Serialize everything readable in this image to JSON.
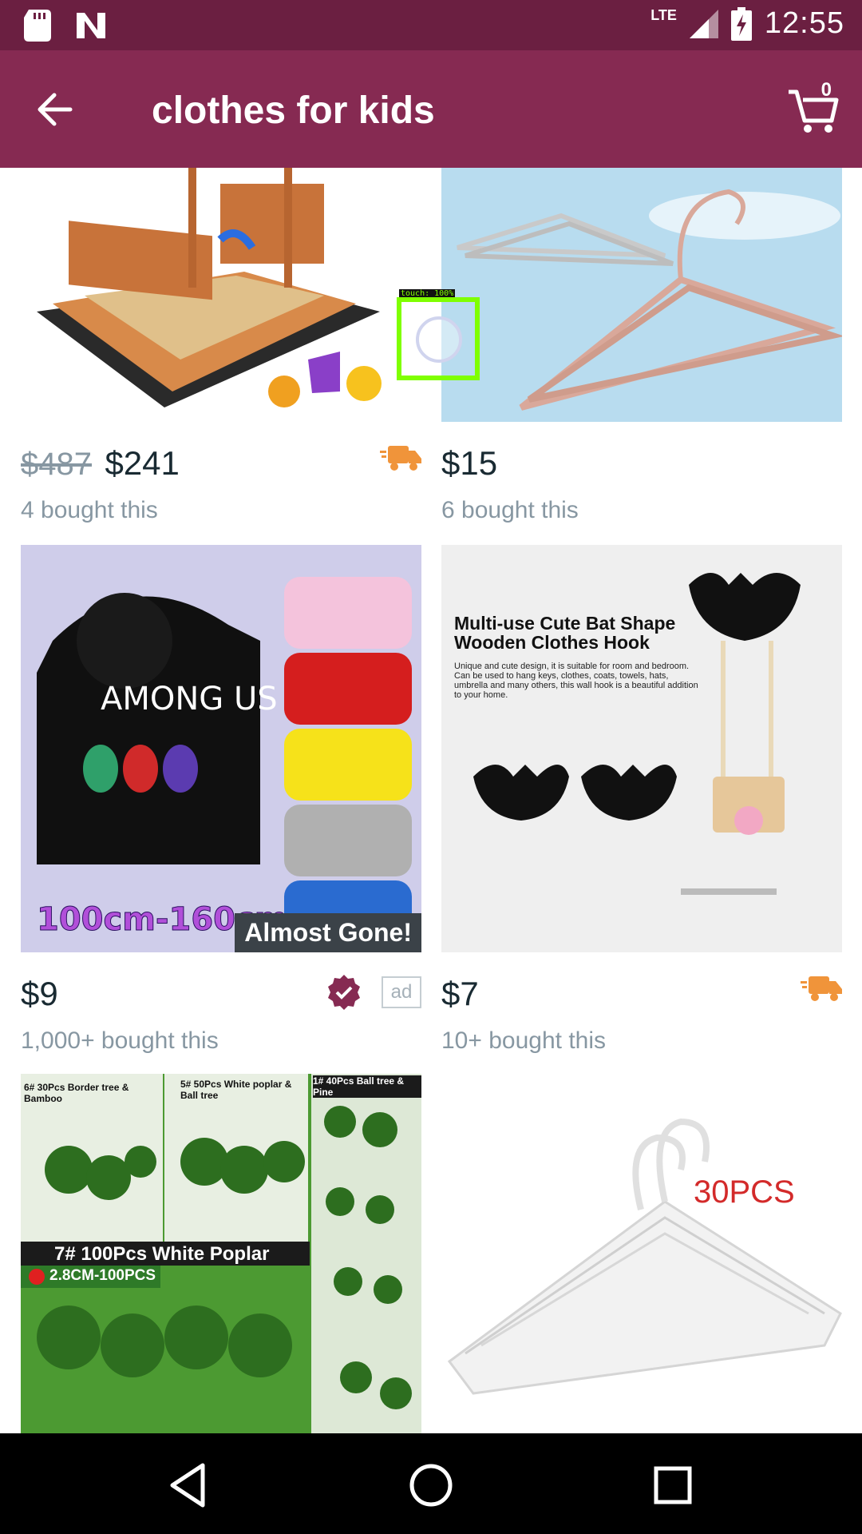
{
  "status_bar": {
    "time": "12:55",
    "network": "LTE"
  },
  "app_bar": {
    "title": "clothes for kids",
    "cart_count": "0"
  },
  "products": [
    {
      "old_price": "$487",
      "price": "$241",
      "bought": "4 bought this",
      "image": "wooden sandbox with toys",
      "shipping_icon": "truck-icon"
    },
    {
      "price": "$15",
      "bought": "6 bought this",
      "image": "metal clothes hangers"
    },
    {
      "price": "$9",
      "bought": "1,000+ bought this",
      "badge": "Almost Gone!",
      "ad_label": "ad",
      "image": "AMONG US hoodies",
      "image_text_main": "AMONG US",
      "image_text_size": "100cm-160cm"
    },
    {
      "price": "$7",
      "bought": "10+ bought this",
      "image": "bat shape wooden hooks",
      "image_heading": "Multi-use Cute Bat Shape Wooden Clothes Hook",
      "image_body": "Unique and cute design, it is suitable for room and bedroom. Can be used to hang keys, clothes, coats, towels, hats, umbrella and many others, this wall hook is a beautiful addition to your home.",
      "shipping_icon": "truck-icon"
    },
    {
      "image": "model trees",
      "image_labels": [
        "6# 30Pcs Border tree & Bamboo",
        "5# 50Pcs White poplar & Ball tree",
        "1# 40Pcs Ball tree & Pine",
        "7# 100Pcs White Poplar",
        "2.8CM-100PCS"
      ]
    },
    {
      "image": "white clothes hangers",
      "image_text": "30PCS"
    }
  ],
  "overlay": {
    "touch_label": "touch: 100%"
  },
  "colors": {
    "status_bar": "#6b1f41",
    "app_bar": "#862a52",
    "accent_truck": "#f0943a",
    "verified": "#862a52"
  }
}
